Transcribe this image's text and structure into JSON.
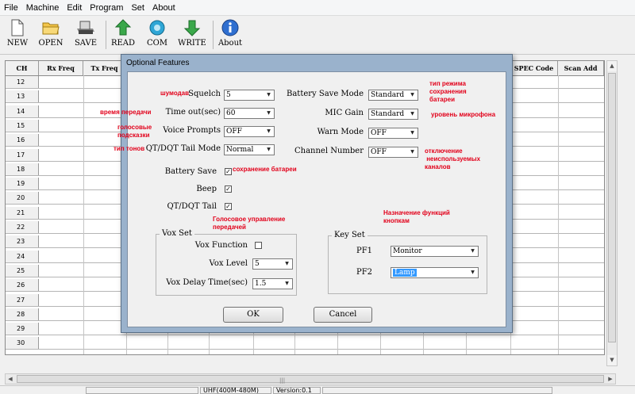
{
  "menu": [
    "File",
    "Machine",
    "Edit",
    "Program",
    "Set",
    "About"
  ],
  "toolbar": {
    "new": "NEW",
    "open": "OPEN",
    "save": "SAVE",
    "read": "READ",
    "com": "COM",
    "write": "WRITE",
    "about": "About"
  },
  "grid": {
    "headers": {
      "ch": "CH",
      "rx": "Rx Freq",
      "tx": "Tx Freq",
      "spec": "SPEC Code",
      "scan": "Scan Add"
    },
    "rows": [
      "12",
      "13",
      "14",
      "15",
      "16",
      "17",
      "18",
      "19",
      "20",
      "21",
      "22",
      "23",
      "24",
      "25",
      "26",
      "27",
      "28",
      "29",
      "30"
    ]
  },
  "status": {
    "band": "UHF(400M-480M)",
    "version": "Version:0.1"
  },
  "dialog": {
    "title": "Optional Features",
    "squelch": {
      "label": "Squelch",
      "value": "5"
    },
    "timeout": {
      "label": "Time out(sec)",
      "value": "60"
    },
    "voice": {
      "label": "Voice Prompts",
      "value": "OFF"
    },
    "tail_mode": {
      "label": "QT/DQT Tail Mode",
      "value": "Normal"
    },
    "battery_mode": {
      "label": "Battery Save Mode",
      "value": "Standard"
    },
    "mic_gain": {
      "label": "MIC Gain",
      "value": "Standard"
    },
    "warn_mode": {
      "label": "Warn Mode",
      "value": "OFF"
    },
    "channel_number": {
      "label": "Channel Number",
      "value": "OFF"
    },
    "battery_save": {
      "label": "Battery Save",
      "checked": true
    },
    "beep": {
      "label": "Beep",
      "checked": true
    },
    "tail": {
      "label": "QT/DQT Tail",
      "checked": true
    },
    "vox": {
      "title": "Vox Set",
      "function": {
        "label": "Vox Function",
        "checked": false
      },
      "level": {
        "label": "Vox Level",
        "value": "5"
      },
      "delay": {
        "label": "Vox Delay Time(sec)",
        "value": "1.5"
      }
    },
    "keys": {
      "title": "Key Set",
      "pf1": {
        "label": "PF1",
        "value": "Monitor"
      },
      "pf2": {
        "label": "PF2",
        "value": "Lamp"
      }
    },
    "ok": "OK",
    "cancel": "Cancel"
  },
  "annotations": {
    "squelch": "шумодав",
    "timeout": "время передачи",
    "voice": "голосовые\nподсказки",
    "tail_mode": "тип тонов",
    "battery_save": "сохранение батареи",
    "vox": "Голосовое управление\nпередачей",
    "keys": "Назначение функций\nкнопкам",
    "battery_mode": "тип режима\nсохранения\nбатареи",
    "mic_gain": "уровень микрофона",
    "channel_number": "отключение\n неиспользуемых\nканалов"
  },
  "colors": {
    "annotation": "#e2001a",
    "selection": "#3399ff",
    "dialog_frame": "#9ab2cc"
  }
}
